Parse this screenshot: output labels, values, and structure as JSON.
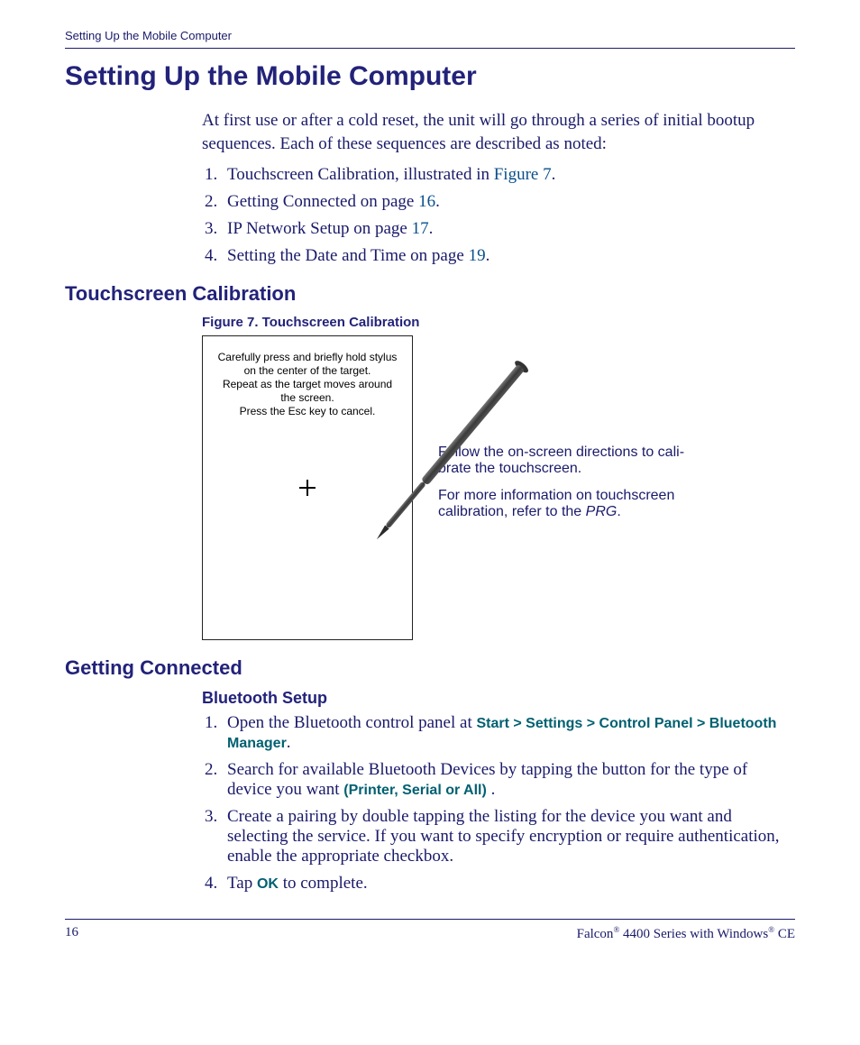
{
  "header": {
    "running": "Setting Up the Mobile Computer"
  },
  "title": "Setting Up the Mobile Computer",
  "intro": "At first use or after a cold reset, the unit will go through a series of initial bootup sequences. Each of these sequences are described as noted:",
  "seq": {
    "i1a": "Touchscreen Calibration, illustrated in ",
    "i1b": "Figure 7",
    "i1c": ".",
    "i2a": "Getting Connected on page ",
    "i2b": "16",
    "i2c": ".",
    "i3a": "IP Network Setup on page ",
    "i3b": "17",
    "i3c": ".",
    "i4a": "Setting the Date and Time on page ",
    "i4b": "19",
    "i4c": "."
  },
  "section_touch": "Touchscreen Calibration",
  "fig_caption": "Figure 7. Touchscreen Calibration",
  "calib": {
    "l1": "Carefully press and briefly hold stylus",
    "l2": "on the center of the target.",
    "l3": "Repeat as the target moves around",
    "l4": "the screen.",
    "l5": "Press the Esc key to cancel."
  },
  "side": {
    "p1": "Follow the on-screen directions to cali­brate the touchscreen.",
    "p2a": "For more information on touchscreen calibration, refer to the ",
    "p2b": "PRG",
    "p2c": "."
  },
  "section_conn": "Getting Connected",
  "sub_bt": "Bluetooth Setup",
  "bt": {
    "s1a": "Open the Bluetooth control panel at ",
    "s1b": "Start > Settings > Control Panel > Bluetooth Manager",
    "s1c": ".",
    "s2a": "Search for available Bluetooth Devices by tapping the button for the type of device you want ",
    "s2b": "(Printer, Serial or All)",
    "s2c": " .",
    "s3": "Create a pairing by double tapping the listing for the device you want and selecting the service. If you want to specify encryption or require authentication, enable the appropriate checkbox.",
    "s4a": "Tap ",
    "s4b": "OK",
    "s4c": " to complete."
  },
  "footer": {
    "page": "16",
    "product_a": "Falcon",
    "product_b": " 4400 Series with Windows",
    "product_c": " CE",
    "reg": "®"
  }
}
